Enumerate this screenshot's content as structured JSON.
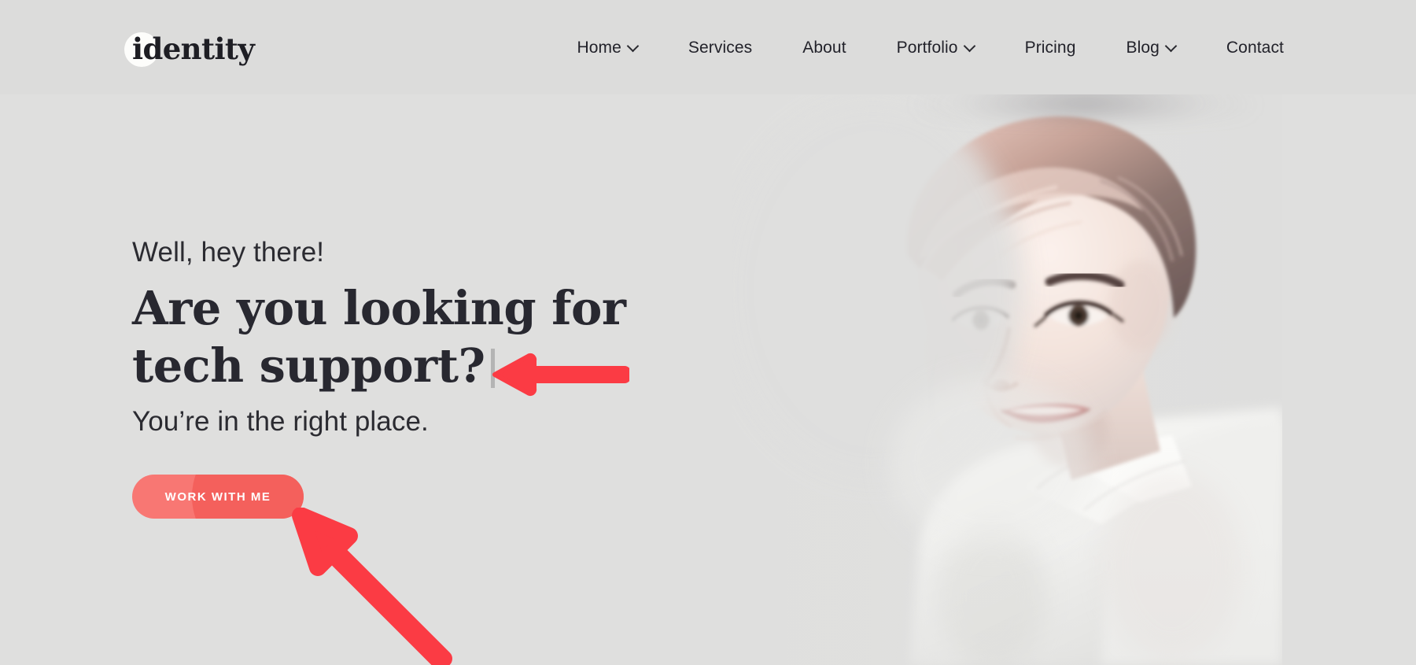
{
  "site": {
    "logo_text": "identity",
    "background_color": "#dedede",
    "accent_color": "#f87773",
    "annotation_color": "#fb3b44",
    "heading_color": "#282830"
  },
  "header": {
    "nav": [
      {
        "label": "Home",
        "has_dropdown": true,
        "icon": "chevron-down-icon"
      },
      {
        "label": "Services",
        "has_dropdown": false,
        "icon": ""
      },
      {
        "label": "About",
        "has_dropdown": false,
        "icon": ""
      },
      {
        "label": "Portfolio",
        "has_dropdown": true,
        "icon": "chevron-down-icon"
      },
      {
        "label": "Pricing",
        "has_dropdown": false,
        "icon": ""
      },
      {
        "label": "Blog",
        "has_dropdown": true,
        "icon": "chevron-down-icon"
      },
      {
        "label": "Contact",
        "has_dropdown": false,
        "icon": ""
      }
    ]
  },
  "hero": {
    "eyebrow": "Well, hey there!",
    "headline": "Are you looking for\ntech support?",
    "typing_caret_visible": true,
    "subheadline": "You’re in the right place.",
    "cta_label": "Work with me",
    "portrait_alt": "smiling woman with short hair in white shirt"
  },
  "annotations": [
    {
      "name": "arrow-pointing-left-at-headline",
      "direction": "left",
      "color": "#fb3b44",
      "target": "headline-typing-caret"
    },
    {
      "name": "arrow-pointing-up-at-cta",
      "direction": "up-left",
      "color": "#fb3b44",
      "target": "work-with-me-button"
    }
  ]
}
